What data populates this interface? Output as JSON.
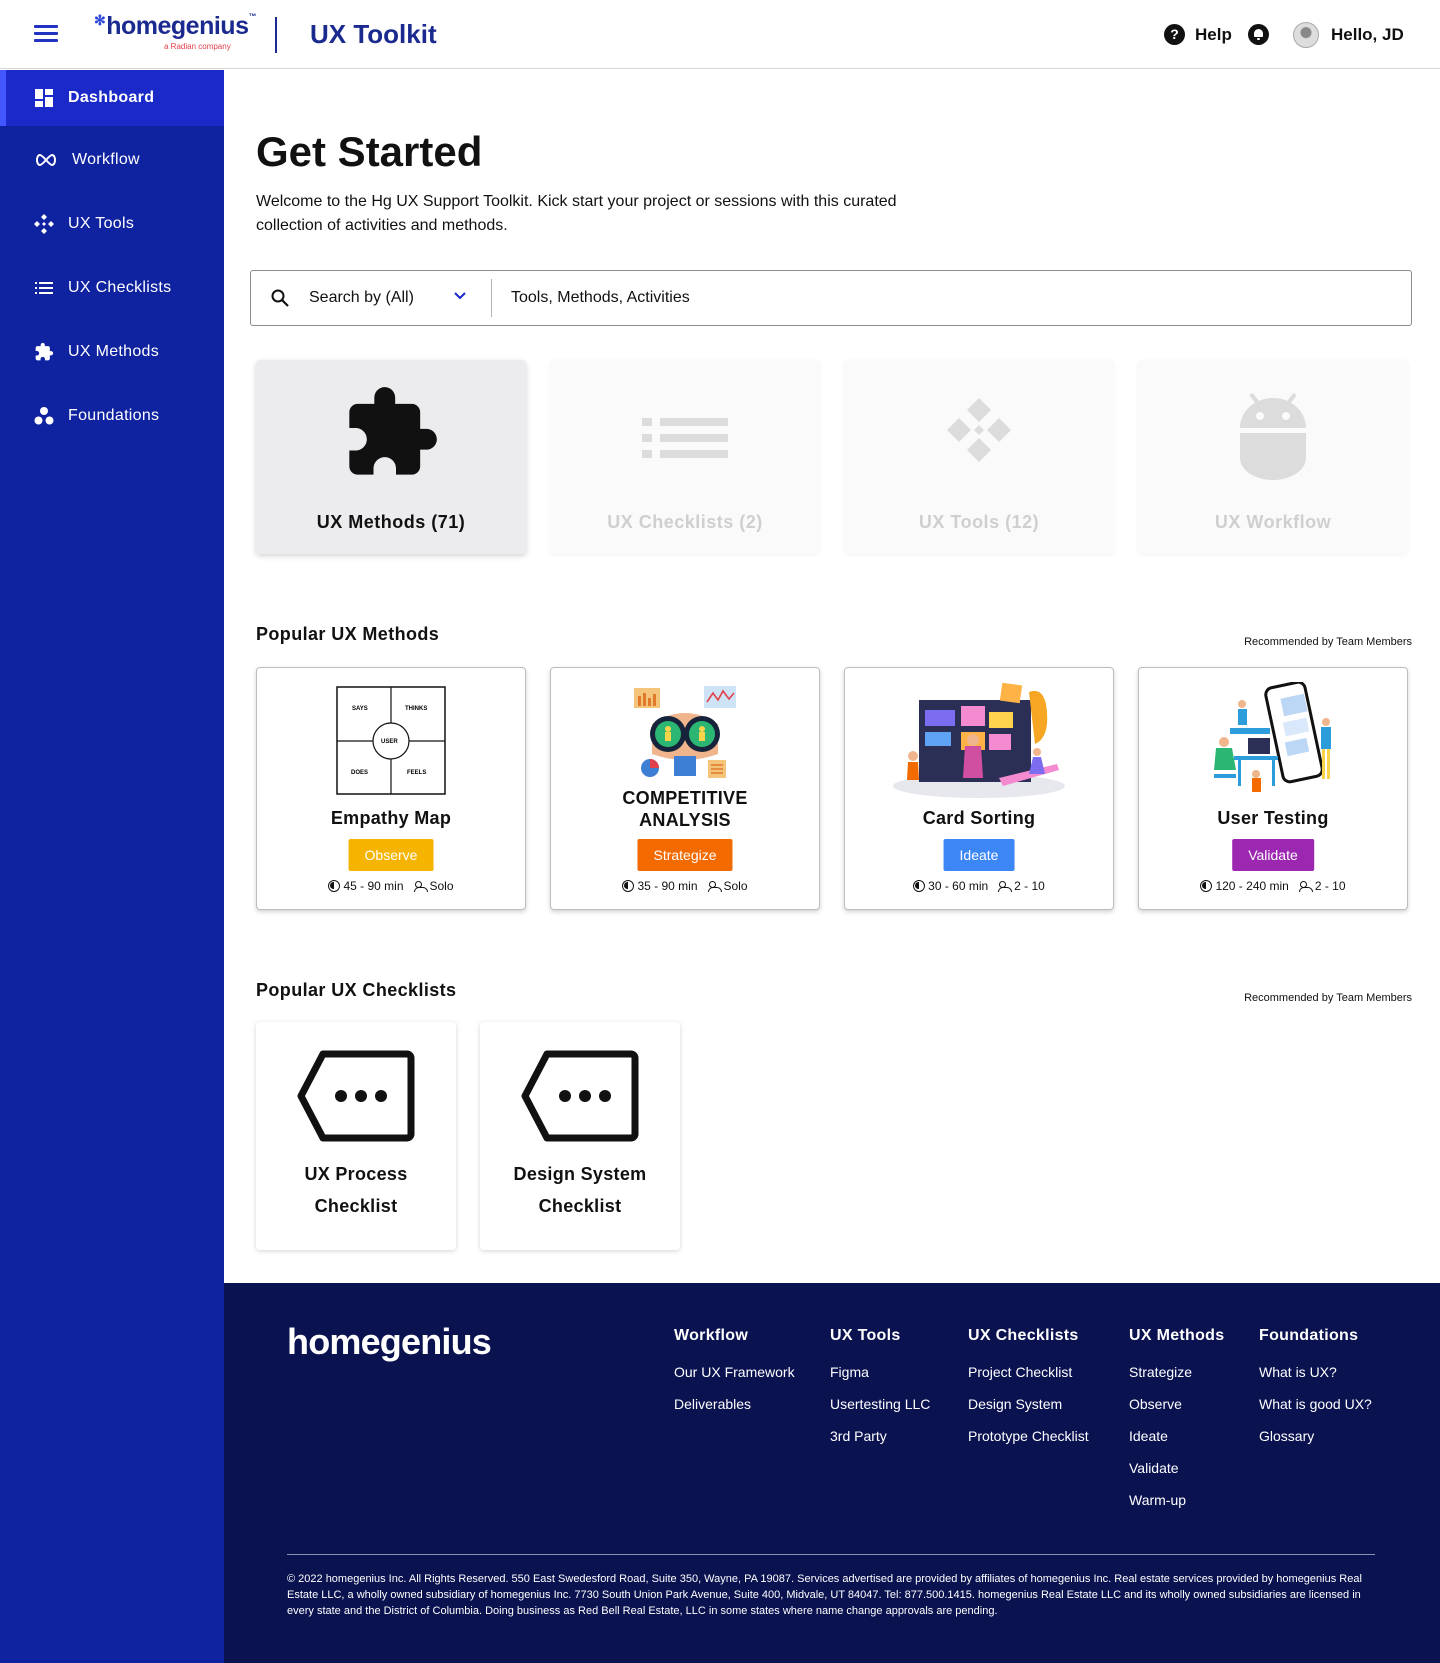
{
  "header": {
    "logo_text": "homegenius",
    "logo_tm": "™",
    "logo_sub": "a Radian company",
    "app_title": "UX Toolkit",
    "help_label": "Help",
    "greeting": "Hello, JD"
  },
  "sidebar": {
    "items": [
      {
        "label": "Dashboard",
        "icon": "dashboard-icon",
        "active": true
      },
      {
        "label": "Workflow",
        "icon": "infinity-icon"
      },
      {
        "label": "UX Tools",
        "icon": "diamond-dots-icon"
      },
      {
        "label": "UX Checklists",
        "icon": "list-icon"
      },
      {
        "label": "UX Methods",
        "icon": "puzzle-icon"
      },
      {
        "label": "Foundations",
        "icon": "three-dots-icon"
      }
    ]
  },
  "main": {
    "title": "Get Started",
    "intro": "Welcome to the Hg UX Support Toolkit. Kick start your project or sessions with this curated collection of activities and methods.",
    "search": {
      "scope": "Search by (All)",
      "placeholder": "Tools, Methods, Activities"
    },
    "categories": [
      {
        "label": "UX Methods (71)",
        "icon": "puzzle-icon",
        "active": true
      },
      {
        "label": "UX Checklists (2)",
        "icon": "list-icon"
      },
      {
        "label": "UX Tools (12)",
        "icon": "diamond-dots-icon"
      },
      {
        "label": "UX Workflow",
        "icon": "android-icon"
      }
    ],
    "popular_methods": {
      "title": "Popular UX Methods",
      "note": "Recommended by Team Members",
      "items": [
        {
          "name": "Empathy Map",
          "tag": "Observe",
          "tag_color": "#f5b400",
          "duration": "45 - 90 min",
          "people": "Solo",
          "quadrants": [
            "SAYS",
            "THINKS",
            "DOES",
            "FEELS"
          ],
          "center": "USER"
        },
        {
          "name_line1": "COMPETITIVE",
          "name_line2": "ANALYSIS",
          "tag": "Strategize",
          "tag_color": "#f26a00",
          "duration": "35 - 90 min",
          "people": "Solo"
        },
        {
          "name": "Card Sorting",
          "tag": "Ideate",
          "tag_color": "#3d86f5",
          "duration": "30 - 60 min",
          "people": "2 - 10"
        },
        {
          "name": "User Testing",
          "tag": "Validate",
          "tag_color": "#9c27b0",
          "duration": "120 - 240 min",
          "people": "2 - 10"
        }
      ]
    },
    "popular_checklists": {
      "title": "Popular UX Checklists",
      "note": "Recommended by Team Members",
      "items": [
        {
          "line1": "UX Process",
          "line2": "Checklist"
        },
        {
          "line1": "Design System",
          "line2": "Checklist"
        }
      ]
    }
  },
  "footer": {
    "logo": "homegenius",
    "columns": [
      {
        "title": "Workflow",
        "links": [
          "Our UX Framework",
          "Deliverables"
        ]
      },
      {
        "title": "UX Tools",
        "links": [
          "Figma",
          "Usertesting LLC",
          "3rd Party"
        ]
      },
      {
        "title": "UX Checklists",
        "links": [
          "Project Checklist",
          "Design System",
          "Prototype Checklist"
        ]
      },
      {
        "title": "UX Methods",
        "links": [
          "Strategize",
          "Observe",
          "Ideate",
          "Validate",
          "Warm-up"
        ]
      },
      {
        "title": "Foundations",
        "links": [
          "What is UX?",
          "What is good UX?",
          "Glossary"
        ]
      }
    ],
    "legal": "© 2022 homegenius Inc. All Rights Reserved.  550 East Swedesford Road, Suite 350, Wayne, PA 19087. Services advertised are provided by affiliates of homegenius Inc. Real estate services provided by homegenius Real Estate LLC, a wholly owned subsidiary of homegenius Inc. 7730 South Union Park Avenue, Suite 400, Midvale, UT 84047. Tel: 877.500.1415. homegenius Real Estate LLC and its wholly owned subsidiaries are licensed in every state and the District of Columbia. Doing business as Red Bell Real Estate, LLC in some states where name change approvals are pending."
  }
}
